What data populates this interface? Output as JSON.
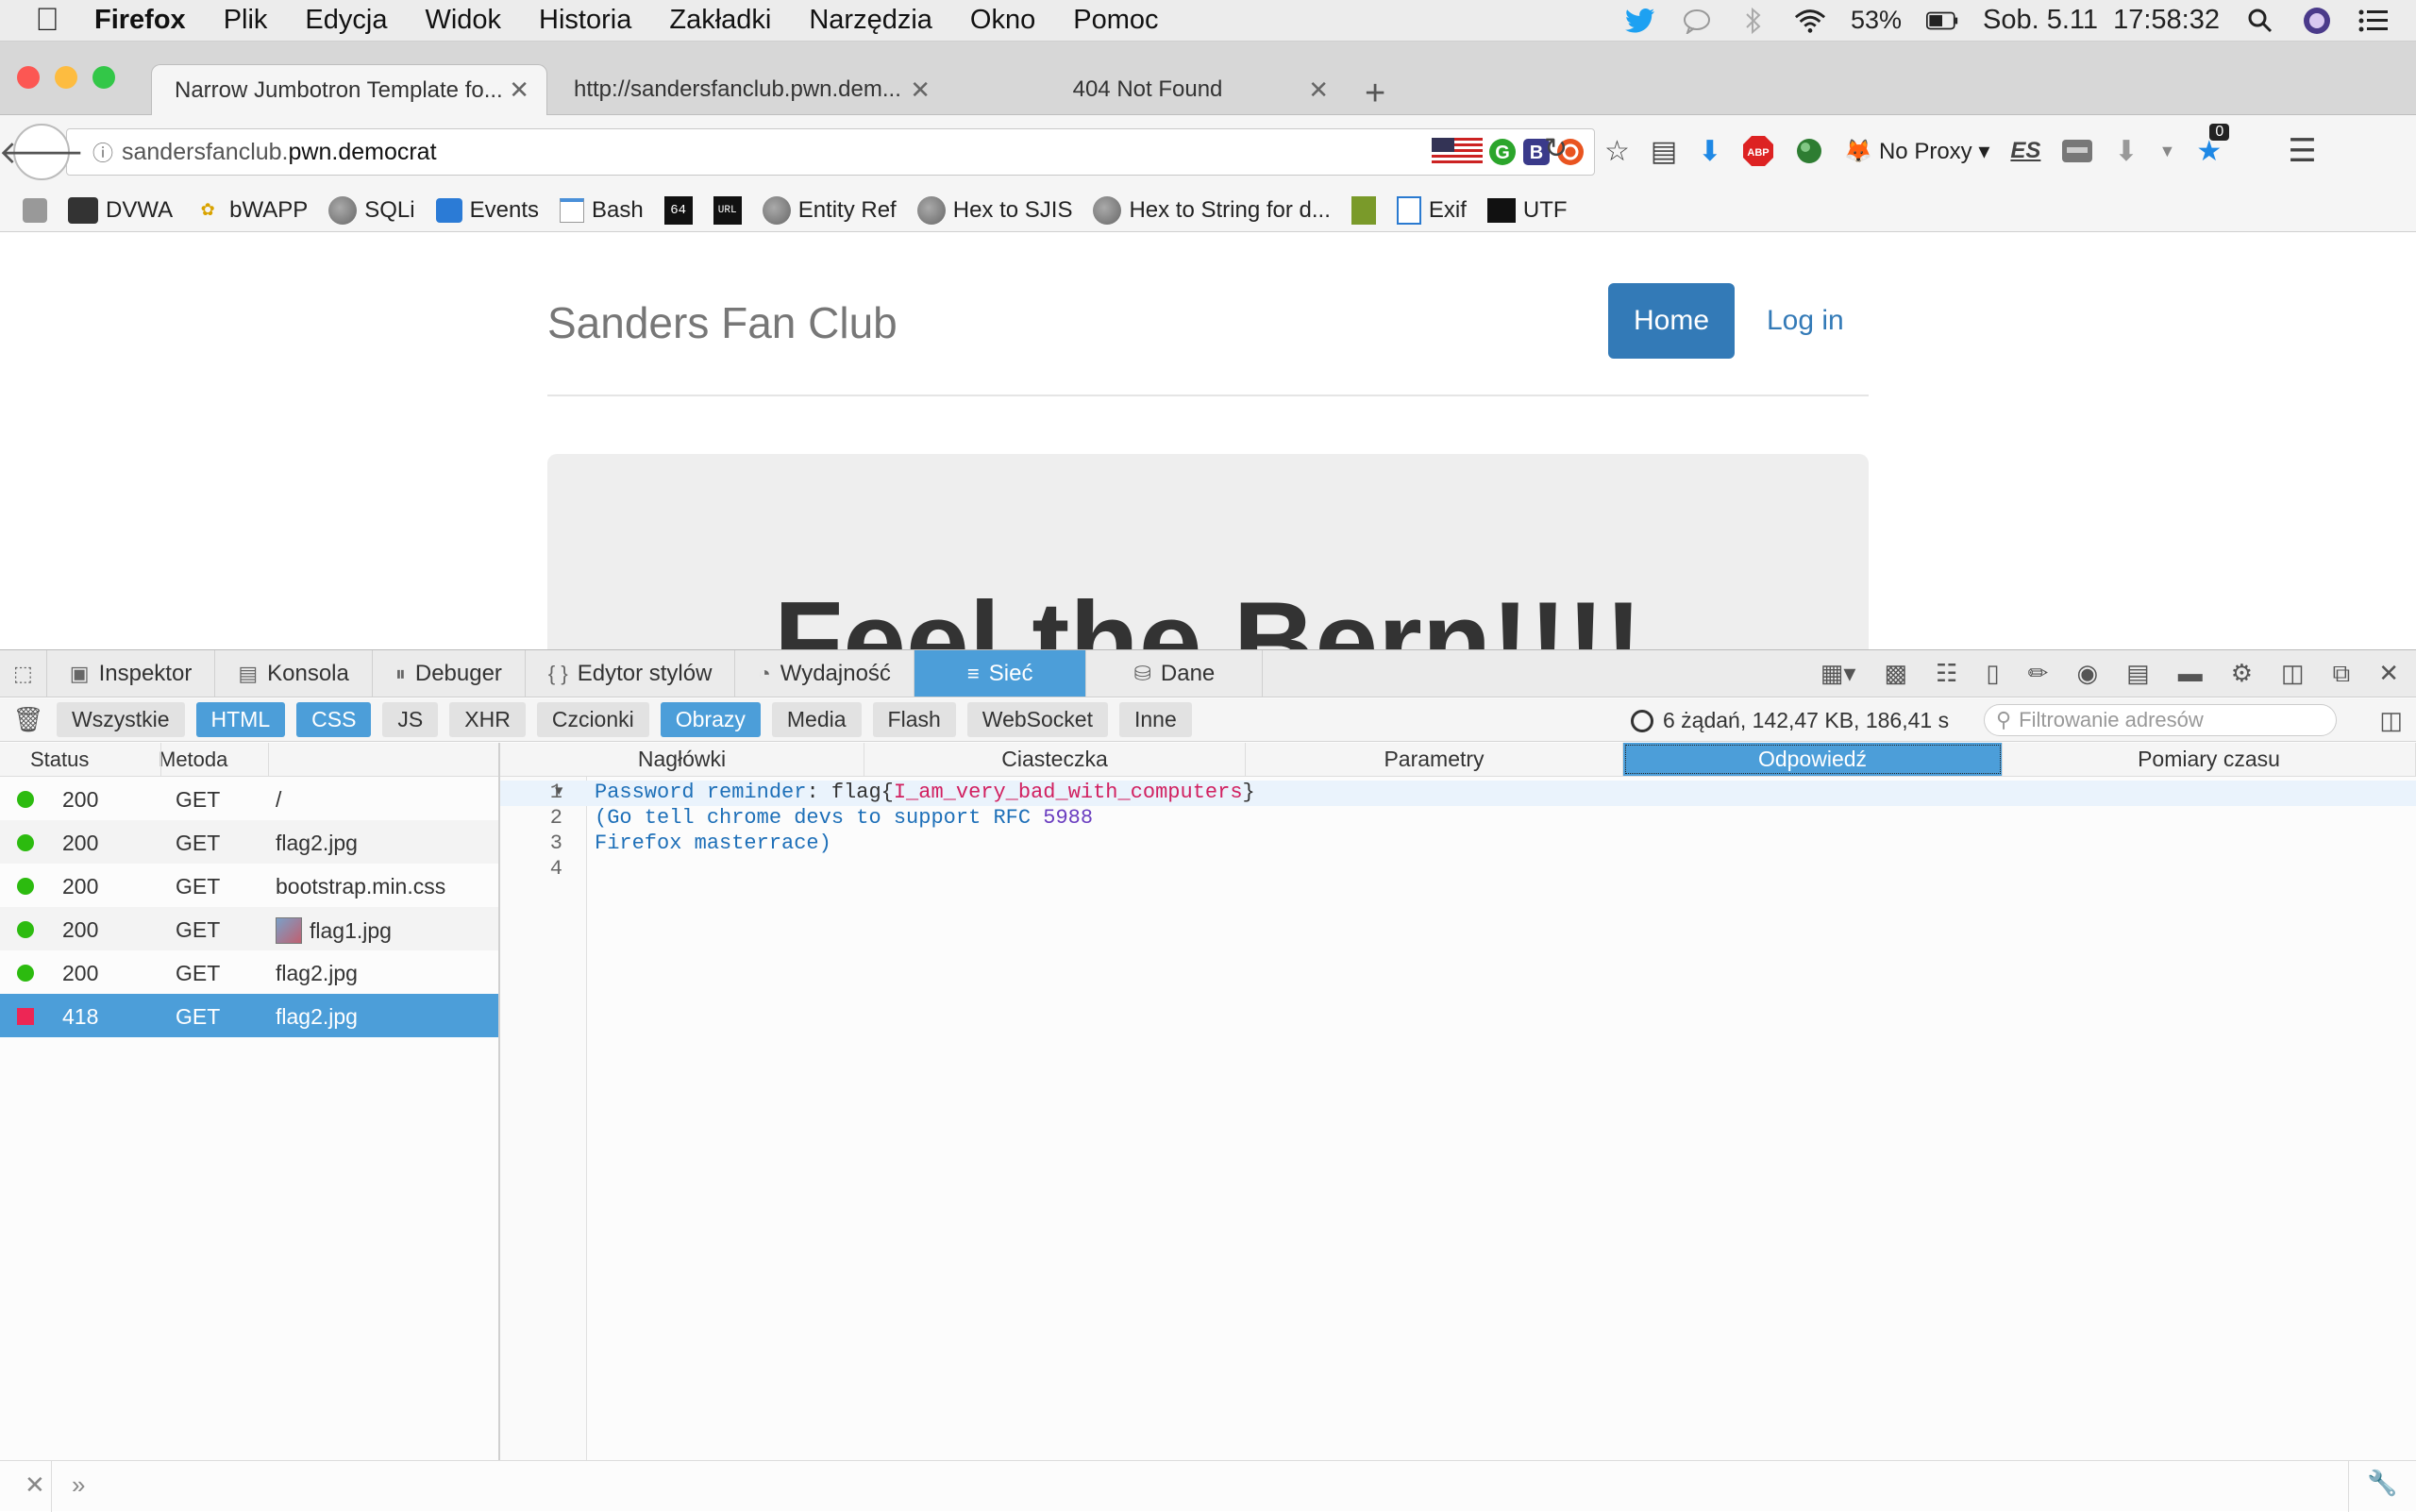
{
  "menubar": {
    "items": [
      "Firefox",
      "Plik",
      "Edycja",
      "Widok",
      "Historia",
      "Zakładki",
      "Narzędzia",
      "Okno",
      "Pomoc"
    ],
    "battery": "53%",
    "datetime": "Sob. 5.11  17:58:32"
  },
  "tabs": [
    {
      "label": "Narrow Jumbotron Template fo..."
    },
    {
      "label": "http://sandersfanclub.pwn.dem..."
    },
    {
      "label": "404 Not Found"
    }
  ],
  "urlbar": {
    "subdomain": "sandersfanclub.",
    "domain": "pwn.democrat"
  },
  "toolbar": {
    "proxy_label": "No Proxy",
    "es_label": "ES",
    "badge_count": "0"
  },
  "bookmarks": [
    "DVWA",
    "bWAPP",
    "SQLi",
    "Events",
    "Bash",
    "",
    "",
    "Entity Ref",
    "Hex to SJIS",
    "Hex to String for d...",
    "",
    "Exif",
    "UTF"
  ],
  "bookmark_icons": {
    "b64": "64",
    "url": "URL"
  },
  "page": {
    "brand": "Sanders Fan Club",
    "nav_home": "Home",
    "nav_login": "Log in",
    "headline": "Feel the Bern!!!!"
  },
  "devtools": {
    "tabs": [
      "Inspektor",
      "Konsola",
      "Debuger",
      "Edytor stylów",
      "Wydajność",
      "Sieć",
      "Dane"
    ],
    "filters": [
      "Wszystkie",
      "HTML",
      "CSS",
      "JS",
      "XHR",
      "Czcionki",
      "Obrazy",
      "Media",
      "Flash",
      "WebSocket",
      "Inne"
    ],
    "summary": "6 żądań, 142,47 KB, 186,41 s",
    "search_placeholder": "Filtrowanie adresów",
    "columns": {
      "status": "Status",
      "method": "Metoda"
    },
    "requests": [
      {
        "status": "200",
        "method": "GET",
        "file": "/"
      },
      {
        "status": "200",
        "method": "GET",
        "file": "flag2.jpg"
      },
      {
        "status": "200",
        "method": "GET",
        "file": "bootstrap.min.css"
      },
      {
        "status": "200",
        "method": "GET",
        "file": "flag1.jpg"
      },
      {
        "status": "200",
        "method": "GET",
        "file": "flag2.jpg"
      },
      {
        "status": "418",
        "method": "GET",
        "file": "flag2.jpg"
      }
    ],
    "detail_tabs": [
      "Nagłówki",
      "Ciasteczka",
      "Parametry",
      "Odpowiedź",
      "Pomiary czasu"
    ],
    "response": {
      "line1_a": "Password reminder",
      "line1_b": ": flag{",
      "line1_c": "I_am_very_bad_with_computers",
      "line1_d": "}",
      "line2_a": "(Go tell chrome devs to support RFC ",
      "line2_b": "5988",
      "line3": "Firefox masterrace)",
      "line_numbers": [
        "1",
        "2",
        "3",
        "4"
      ]
    }
  }
}
